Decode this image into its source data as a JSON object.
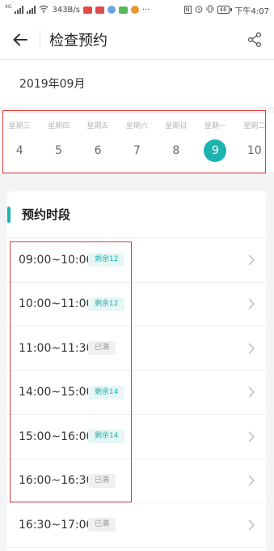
{
  "status_bar": {
    "speed": "343B/s",
    "network": "4G",
    "battery": "46",
    "time": "下午4:07",
    "dots": "···"
  },
  "header": {
    "title": "检查预约"
  },
  "month": "2019年09月",
  "days": [
    {
      "weekday": "星期三",
      "date": "4",
      "selected": false
    },
    {
      "weekday": "星期四",
      "date": "5",
      "selected": false
    },
    {
      "weekday": "星期五",
      "date": "6",
      "selected": false
    },
    {
      "weekday": "星期六",
      "date": "7",
      "selected": false
    },
    {
      "weekday": "星期日",
      "date": "8",
      "selected": false
    },
    {
      "weekday": "星期一",
      "date": "9",
      "selected": true
    },
    {
      "weekday": "星期二",
      "date": "10",
      "selected": false
    }
  ],
  "card": {
    "title": "预约时段"
  },
  "slots": [
    {
      "time": "09:00~10:00",
      "status": "剩余12",
      "available": true
    },
    {
      "time": "10:00~11:00",
      "status": "剩余12",
      "available": true
    },
    {
      "time": "11:00~11:30",
      "status": "已满",
      "available": false
    },
    {
      "time": "14:00~15:00",
      "status": "剩余14",
      "available": true
    },
    {
      "time": "15:00~16:00",
      "status": "剩余14",
      "available": true
    },
    {
      "time": "16:00~16:30",
      "status": "已满",
      "available": false
    },
    {
      "time": "16:30~17:00",
      "status": "已满",
      "available": false
    }
  ],
  "colors": {
    "accent": "#1cb3b0",
    "highlight_frame": "#e03a3a"
  },
  "icons": {
    "back": "arrow-left-icon",
    "share": "share-icon",
    "chevron": "chevron-right-icon"
  }
}
